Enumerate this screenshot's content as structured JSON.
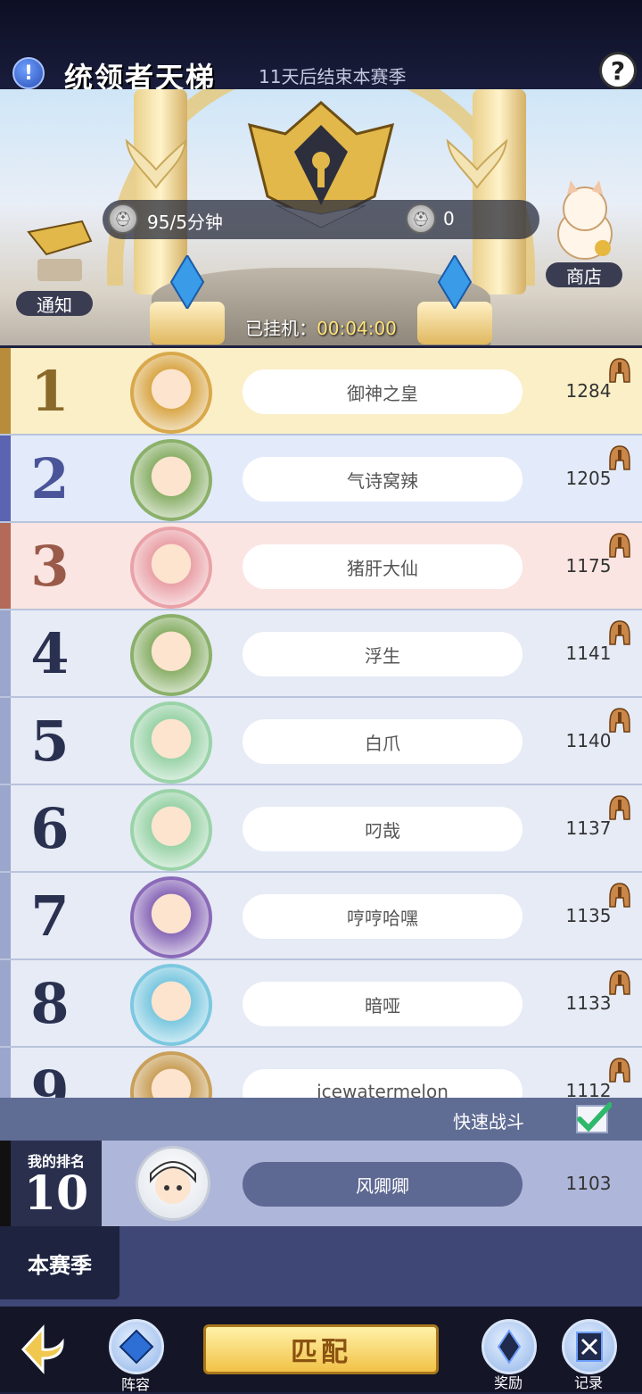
{
  "header": {
    "title": "统领者天梯",
    "season_end": "11天后结束本赛季",
    "help_symbol": "?",
    "alert_symbol": "!"
  },
  "scene": {
    "rate": "95/5分钟",
    "gold": "0",
    "notice_label": "通知",
    "shop_label": "商店",
    "afk_label": "已挂机：",
    "afk_time": "00:04:00"
  },
  "rankings": [
    {
      "rank": "1",
      "name": "御神之皇",
      "score": "1284",
      "theme": "#fbefc8",
      "rank_color": "#8a6a2a",
      "bar": "#b88c3a"
    },
    {
      "rank": "2",
      "name": "气诗窝辣",
      "score": "1205",
      "theme": "#e3ebfa",
      "rank_color": "#4a5599",
      "bar": "#5a64b0"
    },
    {
      "rank": "3",
      "name": "猪肝大仙",
      "score": "1175",
      "theme": "#fbe5e2",
      "rank_color": "#9a5a4a",
      "bar": "#b36a58"
    },
    {
      "rank": "4",
      "name": "浮生",
      "score": "1141",
      "theme": "#e6ebf6",
      "rank_color": "#2a3150",
      "bar": "#9aa6cc"
    },
    {
      "rank": "5",
      "name": "白爪",
      "score": "1140",
      "theme": "#e6ebf6",
      "rank_color": "#2a3150",
      "bar": "#9aa6cc"
    },
    {
      "rank": "6",
      "name": "叼哉",
      "score": "1137",
      "theme": "#e6ebf6",
      "rank_color": "#2a3150",
      "bar": "#9aa6cc"
    },
    {
      "rank": "7",
      "name": "哼哼哈嘿",
      "score": "1135",
      "theme": "#e6ebf6",
      "rank_color": "#2a3150",
      "bar": "#9aa6cc"
    },
    {
      "rank": "8",
      "name": "暗哑",
      "score": "1133",
      "theme": "#e6ebf6",
      "rank_color": "#2a3150",
      "bar": "#9aa6cc"
    },
    {
      "rank": "9",
      "name": "icewatermelon",
      "score": "1112",
      "theme": "#e6ebf6",
      "rank_color": "#2a3150",
      "bar": "#9aa6cc"
    }
  ],
  "quick_battle": {
    "label": "快速战斗",
    "checked": true
  },
  "my_rank": {
    "label": "我的排名",
    "rank": "10",
    "name": "风卿卿",
    "score": "1103"
  },
  "season_tab": "本赛季",
  "bottom": {
    "lineup": "阵容",
    "match": "匹配",
    "rewards": "奖励",
    "records": "记录"
  }
}
